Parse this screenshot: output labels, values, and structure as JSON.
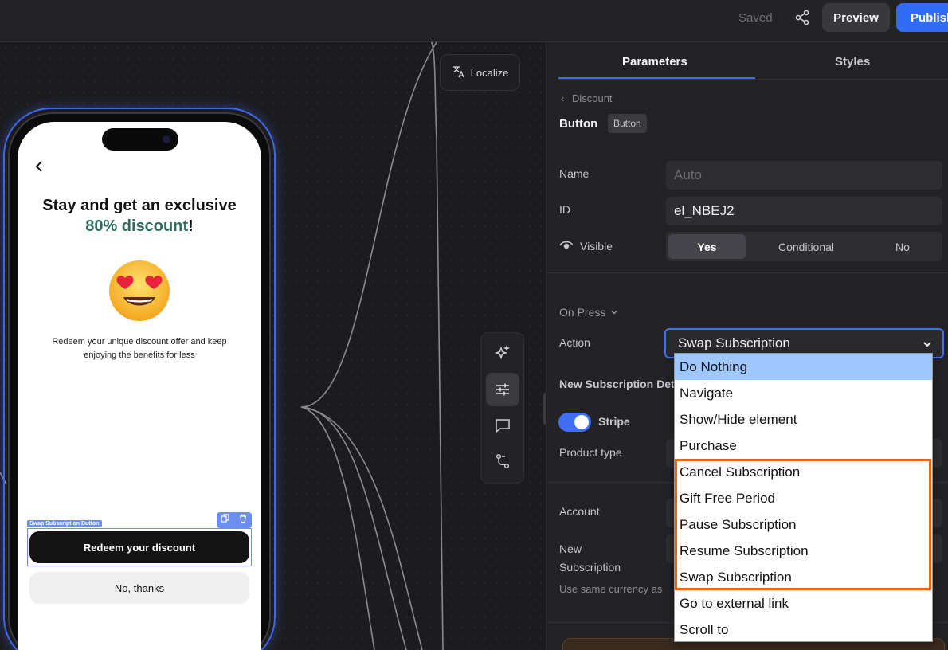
{
  "topbar": {
    "saved_label": "Saved",
    "share_icon": "share-icon",
    "preview_label": "Preview",
    "publish_label": "Publish"
  },
  "canvas": {
    "localize_label": "Localize",
    "localize_icon": "translate-icon",
    "tools": [
      "sparkle-icon",
      "sliders-icon",
      "comment-icon",
      "branch-icon"
    ]
  },
  "phone": {
    "headline_line1": "Stay and get an exclusive",
    "headline_accent": "80% discount",
    "headline_suffix": "!",
    "emoji_icon": "heart-eyes-emoji-icon",
    "body": "Redeem your unique discount offer and keep enjoying the benefits for less",
    "selection_tag": "Swap Subscription Button",
    "primary_button": "Redeem your discount",
    "secondary_button": "No, thanks",
    "accent_color": "#2f6a5e"
  },
  "panel": {
    "tabs": [
      "Parameters",
      "Styles"
    ],
    "active_tab": "Parameters",
    "breadcrumb": "Discount",
    "element_title": "Button",
    "element_badge": "Button",
    "name_label": "Name",
    "name_placeholder": "Auto",
    "id_label": "ID",
    "id_value": "el_NBEJ2",
    "visible_label": "Visible",
    "visible_options": [
      "Yes",
      "Conditional",
      "No"
    ],
    "visible_selected": "Yes",
    "on_press_label": "On Press",
    "action_label": "Action",
    "action_value": "Swap Subscription",
    "new_sub_section": "New Subscription Det",
    "stripe_label": "Stripe",
    "product_type_label": "Product type",
    "account_label": "Account",
    "new_subscription_label_1": "New",
    "new_subscription_label_2": "Subscription",
    "currency_note": "Use same currency as"
  },
  "dropdown": {
    "options": [
      "Do Nothing",
      "Navigate",
      "Show/Hide element",
      "Purchase",
      "Cancel Subscription",
      "Gift Free Period",
      "Pause Subscription",
      "Resume Subscription",
      "Swap Subscription",
      "Go to external link",
      "Scroll to"
    ],
    "hovered": "Do Nothing",
    "highlight_color": "#e0661c"
  }
}
